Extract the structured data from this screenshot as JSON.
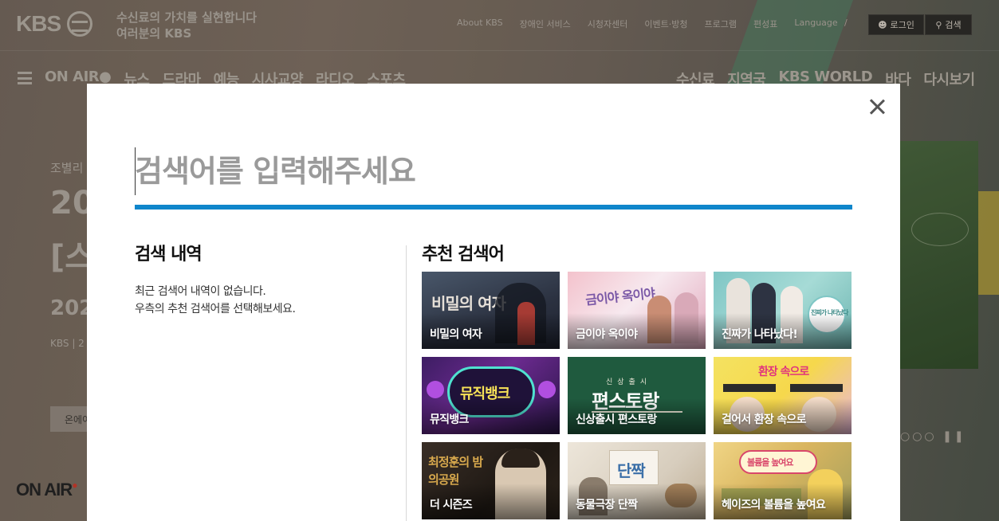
{
  "header": {
    "logo": "KBS",
    "slogan_line1": "수신료의 가치를 실현합니다",
    "slogan_line2": "여러분의 KBS",
    "links": [
      "About KBS",
      "장애인 서비스",
      "시청자센터",
      "이벤트·방청",
      "프로그램",
      "편성표",
      "Language"
    ],
    "separator": "/",
    "login_label": "로그인",
    "search_label": "검색"
  },
  "nav": {
    "left": [
      "ON AIR",
      "뉴스",
      "드라마",
      "예능",
      "시사교양",
      "라디오",
      "스포츠"
    ],
    "right": [
      "수신료",
      "지역국",
      "KBS WORLD",
      "바다",
      "다시보기"
    ]
  },
  "hero": {
    "small": "조별리",
    "big1": "20",
    "big2": "[스",
    "year": "202",
    "meta": "KBS | 2",
    "button": "온에어"
  },
  "footer": {
    "onair": "ON AIR"
  },
  "modal": {
    "search": {
      "placeholder": "검색어를 입력해주세요",
      "value": ""
    },
    "history": {
      "title": "검색 내역",
      "line1": "최근 검색어 내역이 없습니다.",
      "line2": "우측의 추천 검색어를 선택해보세요."
    },
    "recommend": {
      "title": "추천 검색어",
      "items": [
        {
          "label": "비밀의 여자",
          "art": "비밀의 여자"
        },
        {
          "label": "금이야 옥이야",
          "art": "금이야 옥이야"
        },
        {
          "label": "진짜가 나타났다!",
          "art": "진짜가 나타났다"
        },
        {
          "label": "뮤직뱅크",
          "art": "뮤직뱅크"
        },
        {
          "label": "신상출시 편스토랑",
          "art": "편스토랑"
        },
        {
          "label": "걸어서 환장 속으로",
          "art": "환장 속으로"
        },
        {
          "label": "더 시즌즈",
          "art": "최정훈의 밤의공원"
        },
        {
          "label": "동물극장 단짝",
          "art": "단짝"
        },
        {
          "label": "헤이즈의 볼륨을 높여요",
          "art": "볼륨을 높여요"
        }
      ]
    }
  }
}
